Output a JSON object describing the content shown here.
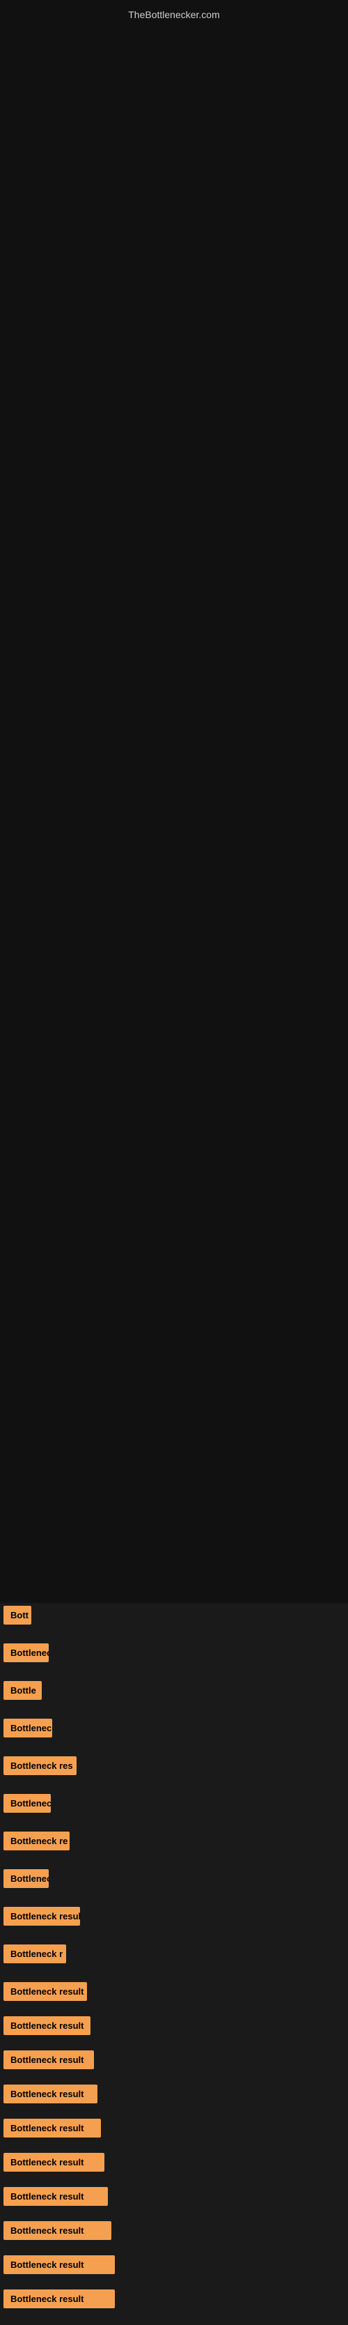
{
  "site": {
    "title": "TheBottlenecker.com"
  },
  "results": [
    {
      "id": 1,
      "label": "Bottleneck result",
      "width_class": "w-40",
      "display": "Bott"
    },
    {
      "id": 2,
      "label": "Bottleneck result",
      "width_class": "w-65",
      "display": "Bottlenec"
    },
    {
      "id": 3,
      "label": "Bottleneck result",
      "width_class": "w-55",
      "display": "Bottle"
    },
    {
      "id": 4,
      "label": "Bottleneck result",
      "width_class": "w-70",
      "display": "Bottleneck"
    },
    {
      "id": 5,
      "label": "Bottleneck result",
      "width_class": "w-105",
      "display": "Bottleneck res"
    },
    {
      "id": 6,
      "label": "Bottleneck result",
      "width_class": "w-68",
      "display": "Bottleneck"
    },
    {
      "id": 7,
      "label": "Bottleneck result",
      "width_class": "w-95",
      "display": "Bottleneck re"
    },
    {
      "id": 8,
      "label": "Bottleneck result",
      "width_class": "w-65b",
      "display": "Bottlenec"
    },
    {
      "id": 9,
      "label": "Bottleneck result",
      "width_class": "w-110",
      "display": "Bottleneck resul"
    },
    {
      "id": 10,
      "label": "Bottleneck result",
      "width_class": "w-90",
      "display": "Bottleneck r"
    },
    {
      "id": 11,
      "label": "Bottleneck result",
      "width_class": "w-120"
    },
    {
      "id": 12,
      "label": "Bottleneck result",
      "width_class": "w-125"
    },
    {
      "id": 13,
      "label": "Bottleneck result",
      "width_class": "w-130"
    },
    {
      "id": 14,
      "label": "Bottleneck result",
      "width_class": "w-135"
    },
    {
      "id": 15,
      "label": "Bottleneck result",
      "width_class": "w-140"
    },
    {
      "id": 16,
      "label": "Bottleneck result",
      "width_class": "w-145"
    },
    {
      "id": 17,
      "label": "Bottleneck result",
      "width_class": "w-150"
    },
    {
      "id": 18,
      "label": "Bottleneck result",
      "width_class": "w-155"
    },
    {
      "id": 19,
      "label": "Bottleneck result",
      "width_class": "w-160"
    },
    {
      "id": 20,
      "label": "Bottleneck result",
      "width_class": "w-160"
    }
  ],
  "colors": {
    "background": "#1a1a1a",
    "chart_bg": "#111111",
    "result_bg": "#f5a050",
    "title_color": "#cccccc"
  }
}
